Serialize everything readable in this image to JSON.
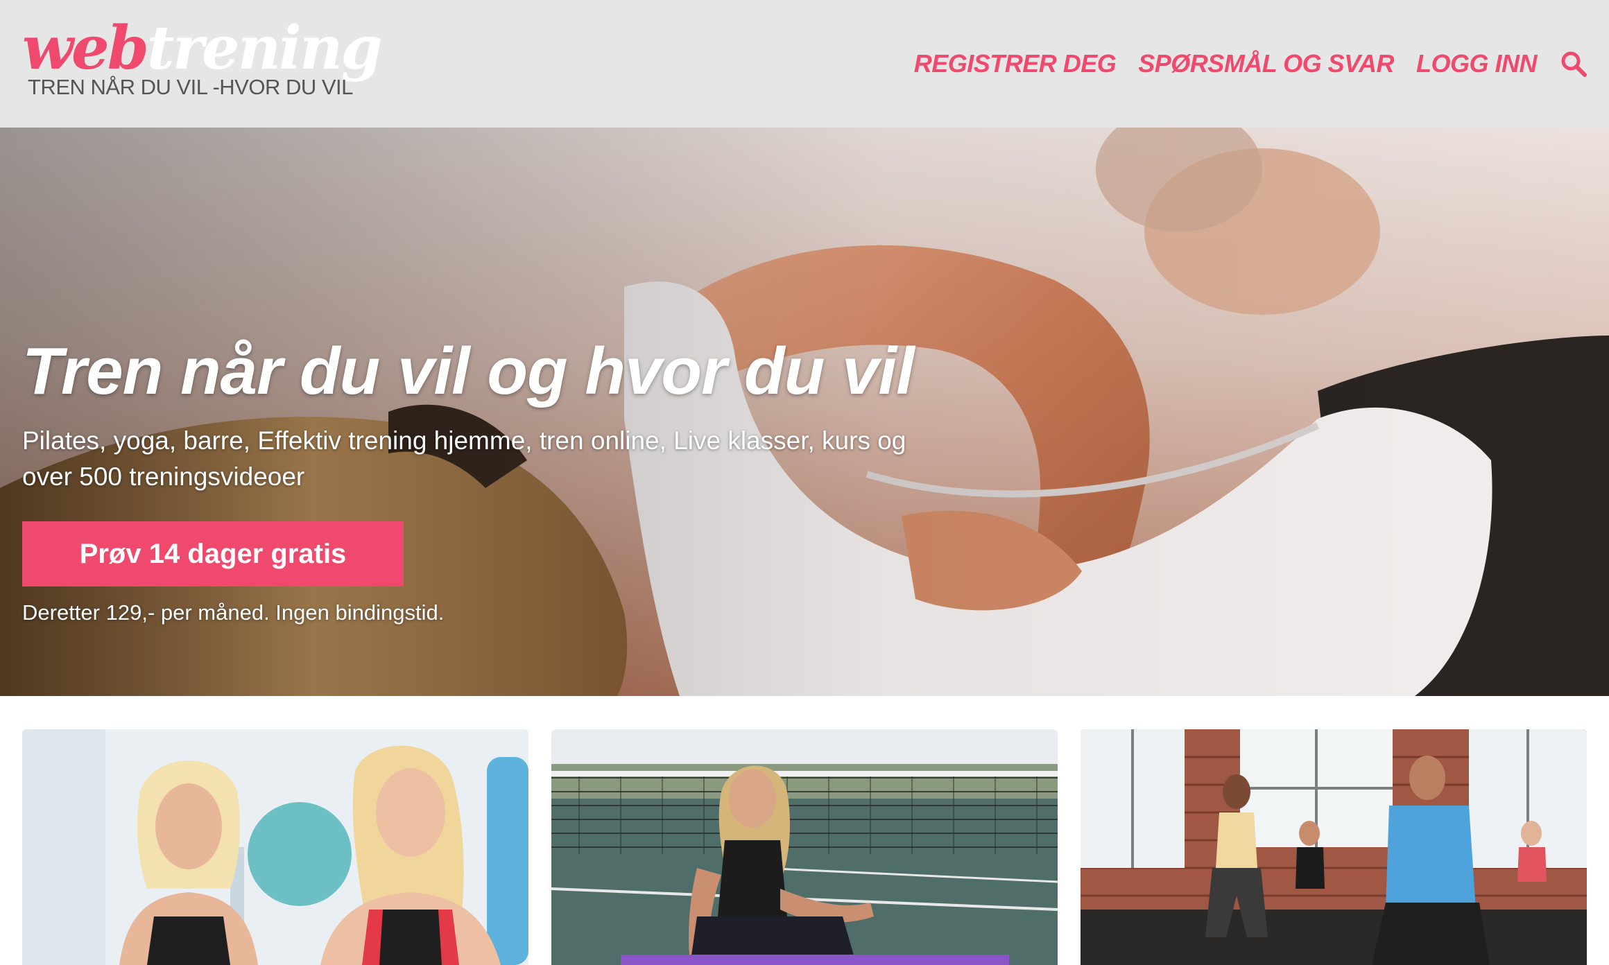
{
  "brand": {
    "logo_part1": "web",
    "logo_part2": "trening",
    "tagline": "TREN NÅR DU VIL -HVOR DU VIL",
    "accent_color": "#ef4a6d"
  },
  "nav": {
    "items": [
      {
        "label": "REGISTRER DEG"
      },
      {
        "label": "SPØRSMÅL OG SVAR"
      },
      {
        "label": "LOGG INN"
      }
    ],
    "search_icon": "search-icon"
  },
  "hero": {
    "title": "Tren når du vil og hvor du vil",
    "subtitle": "Pilates, yoga, barre, Effektiv trening hjemme, tren online, Live klasser, kurs og over 500 treningsvideoer",
    "cta_label": "Prøv 14 dager gratis",
    "note": "Deretter 129,- per måned. Ingen bindingstid."
  },
  "cards": [
    {
      "image": "two-instructors-studio"
    },
    {
      "image": "woman-tennis-court-mat"
    },
    {
      "image": "group-lunges-brick-gym"
    }
  ]
}
